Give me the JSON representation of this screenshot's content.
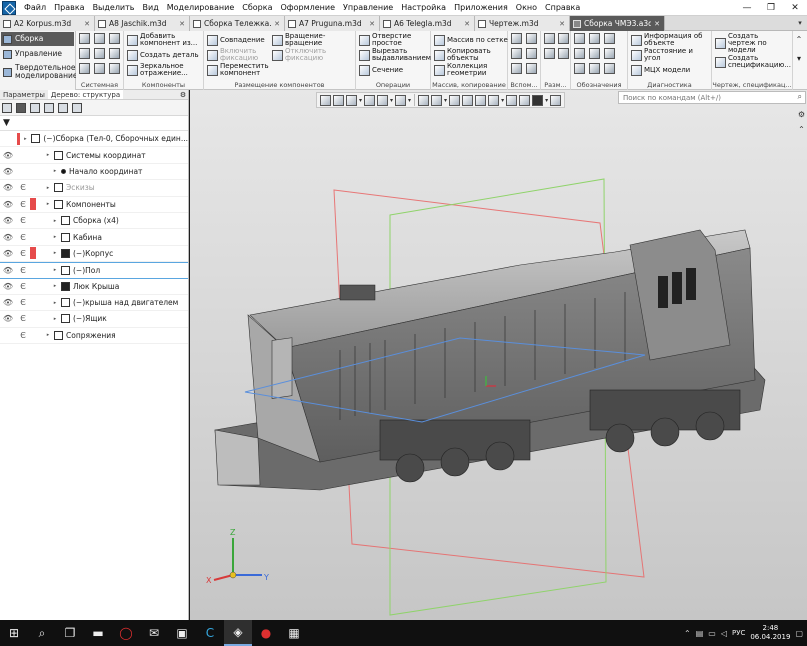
{
  "menu": {
    "items": [
      "Файл",
      "Правка",
      "Выделить",
      "Вид",
      "Моделирование",
      "Сборка",
      "Оформление",
      "Управление",
      "Настройка",
      "Приложения",
      "Окно",
      "Справка"
    ],
    "controls": [
      "—",
      "❐",
      "✕"
    ]
  },
  "doc_tabs": [
    {
      "label": "A2 Korpus.m3d",
      "active": false
    },
    {
      "label": "A8 Jaschik.m3d",
      "active": false
    },
    {
      "label": "Сборка Тележка.a3d",
      "active": false
    },
    {
      "label": "A7 Pruguna.m3d",
      "active": false
    },
    {
      "label": "A6 Telegla.m3d",
      "active": false
    },
    {
      "label": "Чертеж.m3d",
      "active": false
    },
    {
      "label": "Сборка ЧМЭ3.a3d",
      "active": true
    }
  ],
  "categories": [
    {
      "label": "Сборка",
      "active": true
    },
    {
      "label": "Управление",
      "active": false
    },
    {
      "label": "Твердотельное моделирование",
      "active": false
    }
  ],
  "ribbon": {
    "groups": [
      {
        "id": "system",
        "label": "Системная",
        "buttons": []
      },
      {
        "id": "components",
        "label": "Компоненты",
        "buttons": [
          {
            "label": "Добавить компонент из...",
            "dim": false
          },
          {
            "label": "Создать деталь",
            "dim": false
          },
          {
            "label": "Зеркальное отражение...",
            "dim": false
          }
        ]
      },
      {
        "id": "placement",
        "label": "Размещение компонентов",
        "buttons": [
          {
            "label": "Совпадение",
            "dim": false
          },
          {
            "label": "Включить фиксацию",
            "dim": true
          },
          {
            "label": "Переместить компонент",
            "dim": false
          },
          {
            "label": "Вращение-вращение",
            "dim": false
          },
          {
            "label": "Отключить фиксацию",
            "dim": true
          }
        ]
      },
      {
        "id": "operations",
        "label": "Операции",
        "buttons": [
          {
            "label": "Отверстие простое",
            "dim": false
          },
          {
            "label": "Вырезать выдавливанием",
            "dim": false
          },
          {
            "label": "Сечение",
            "dim": false
          }
        ]
      },
      {
        "id": "arrays",
        "label": "Массив, копирование",
        "buttons": [
          {
            "label": "Массив по сетке",
            "dim": false
          },
          {
            "label": "Копировать объекты",
            "dim": false
          },
          {
            "label": "Коллекция геометрии",
            "dim": false
          }
        ]
      },
      {
        "id": "aux",
        "label": "Вспом...",
        "buttons": []
      },
      {
        "id": "dims",
        "label": "Разм...",
        "buttons": []
      },
      {
        "id": "notation",
        "label": "Обозначения",
        "buttons": []
      },
      {
        "id": "diagnostics",
        "label": "Диагностика",
        "buttons": [
          {
            "label": "Информация об объекте",
            "dim": false
          },
          {
            "label": "Расстояние и угол",
            "dim": false
          },
          {
            "label": "МЦХ модели",
            "dim": false
          }
        ]
      },
      {
        "id": "drawing",
        "label": "Чертеж, спецификац...",
        "buttons": [
          {
            "label": "Создать чертеж по модели",
            "dim": false
          },
          {
            "label": "Создать спецификацию...",
            "dim": false
          }
        ]
      }
    ]
  },
  "left_panel": {
    "tabs": [
      "Параметры",
      "Дерево: структура"
    ],
    "tree": [
      {
        "label": "(−)Сборка (Тел-0, Сборочных един...",
        "indent": 0,
        "eye": "",
        "mode": "",
        "warn": true,
        "icon": "assembly",
        "dim": false,
        "selected": false
      },
      {
        "label": "Системы координат",
        "indent": 1,
        "eye": "👁",
        "mode": "",
        "warn": false,
        "icon": "coords",
        "dim": false,
        "selected": false
      },
      {
        "label": "Начало координат",
        "indent": 2,
        "eye": "👁",
        "mode": "",
        "warn": false,
        "icon": "dot",
        "dim": false,
        "selected": false
      },
      {
        "label": "Эскизы",
        "indent": 1,
        "eye": "👁",
        "mode": "Є",
        "warn": false,
        "icon": "sketch",
        "dim": true,
        "selected": false
      },
      {
        "label": "Компоненты",
        "indent": 1,
        "eye": "👁",
        "mode": "Є",
        "warn": true,
        "icon": "components",
        "dim": false,
        "selected": false
      },
      {
        "label": "Сборка (х4)",
        "indent": 2,
        "eye": "👁",
        "mode": "Є",
        "warn": false,
        "icon": "assembly",
        "dim": false,
        "selected": false
      },
      {
        "label": "Кабина",
        "indent": 2,
        "eye": "👁",
        "mode": "Є",
        "warn": false,
        "icon": "part",
        "dim": false,
        "selected": false
      },
      {
        "label": "(−)Корпус",
        "indent": 2,
        "eye": "👁",
        "mode": "Є",
        "warn": true,
        "icon": "part-dark",
        "dim": false,
        "selected": false
      },
      {
        "label": "(−)Пол",
        "indent": 2,
        "eye": "👁",
        "mode": "Є",
        "warn": false,
        "icon": "part",
        "dim": false,
        "selected": true
      },
      {
        "label": "Люк Крыша",
        "indent": 2,
        "eye": "👁",
        "mode": "Є",
        "warn": false,
        "icon": "part-dark",
        "dim": false,
        "selected": false
      },
      {
        "label": "(−)крыша над двигателем",
        "indent": 2,
        "eye": "👁",
        "mode": "Є",
        "warn": false,
        "icon": "part",
        "dim": false,
        "selected": false
      },
      {
        "label": "(−)Ящик",
        "indent": 2,
        "eye": "👁",
        "mode": "Є",
        "warn": false,
        "icon": "part",
        "dim": false,
        "selected": false
      },
      {
        "label": "Сопряжения",
        "indent": 1,
        "eye": "",
        "mode": "Є",
        "warn": false,
        "icon": "mates",
        "dim": false,
        "selected": false
      }
    ]
  },
  "search": {
    "placeholder": "Поиск по командам (Alt+/)"
  },
  "axes": {
    "x": "X",
    "y": "Y",
    "z": "Z"
  },
  "taskbar": {
    "apps": [
      "start-icon",
      "search-icon",
      "task-view-icon",
      "explorer-icon",
      "opera-icon",
      "mail-icon",
      "save-icon",
      "app-c-icon",
      "kompas-icon",
      "record-icon",
      "calculator-icon"
    ],
    "lang": "РУС",
    "time": "2:48",
    "date": "06.04.2019"
  },
  "colors": {
    "accent": "#5a5a5a",
    "warn": "#e64b4b",
    "selection": "#5aa6e0",
    "plane_red": "#e86a6a",
    "plane_green": "#8fd36a",
    "plane_blue": "#5a8fdc"
  }
}
